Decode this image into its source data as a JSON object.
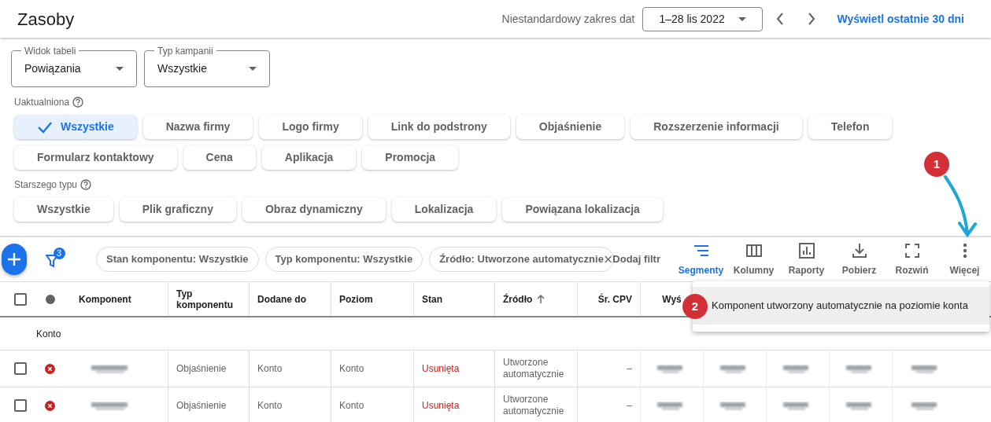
{
  "header": {
    "title": "Zasoby",
    "date_range_label": "Niestandardowy zakres dat",
    "date_range_value": "1–28 lis 2022",
    "link": "Wyświetl ostatnie 30 dni"
  },
  "selects": [
    {
      "label": "Widok tabeli",
      "value": "Powiązania"
    },
    {
      "label": "Typ kampanii",
      "value": "Wszystkie"
    }
  ],
  "chip_groups": [
    {
      "label": "Uaktualniona",
      "chips": [
        {
          "label": "Wszystkie",
          "selected": true
        },
        {
          "label": "Nazwa firmy",
          "selected": false
        },
        {
          "label": "Logo firmy",
          "selected": false
        },
        {
          "label": "Link do podstrony",
          "selected": false
        },
        {
          "label": "Objaśnienie",
          "selected": false
        },
        {
          "label": "Rozszerzenie informacji",
          "selected": false
        },
        {
          "label": "Telefon",
          "selected": false
        },
        {
          "label": "Formularz kontaktowy",
          "selected": false
        },
        {
          "label": "Cena",
          "selected": false
        },
        {
          "label": "Aplikacja",
          "selected": false
        },
        {
          "label": "Promocja",
          "selected": false
        }
      ]
    },
    {
      "label": "Starszego typu",
      "chips": [
        {
          "label": "Wszystkie",
          "selected": false
        },
        {
          "label": "Plik graficzny",
          "selected": false
        },
        {
          "label": "Obraz dynamiczny",
          "selected": false
        },
        {
          "label": "Lokalizacja",
          "selected": false
        },
        {
          "label": "Powiązana lokalizacja",
          "selected": false
        }
      ]
    }
  ],
  "toolbar": {
    "filter_count": "3",
    "filters": [
      "Stan komponentu: Wszystkie",
      "Typ komponentu: Wszystkie",
      "Źródło: Utworzone automatycznie"
    ],
    "add_filter": "Dodaj filtr",
    "actions": [
      {
        "kind": "segments",
        "label": "Segmenty",
        "selected": true
      },
      {
        "kind": "columns",
        "label": "Kolumny",
        "selected": false
      },
      {
        "kind": "reports",
        "label": "Raporty",
        "selected": false
      },
      {
        "kind": "download",
        "label": "Pobierz",
        "selected": false
      },
      {
        "kind": "expand",
        "label": "Rozwiń",
        "selected": false
      },
      {
        "kind": "more",
        "label": "Więcej",
        "selected": false
      }
    ]
  },
  "table": {
    "columns": [
      {
        "label": "Komponent"
      },
      {
        "label": "Typ komponentu"
      },
      {
        "label": "Dodane do"
      },
      {
        "label": "Poziom"
      },
      {
        "label": "Stan"
      },
      {
        "label": "Źródło",
        "sorted_ascending": true
      },
      {
        "label": "Śr. CPV"
      },
      {
        "label": "Wyś"
      }
    ],
    "select_all_checked": false,
    "group_label": "Konto",
    "rows": [
      {
        "checked": false,
        "removed": true,
        "type": "Objaśnienie",
        "added_to": "Konto",
        "level": "Konto",
        "status": "Usunięta",
        "source": "Utworzone automatycznie",
        "cpv": "–"
      },
      {
        "checked": false,
        "removed": true,
        "type": "Objaśnienie",
        "added_to": "Konto",
        "level": "Konto",
        "status": "Usunięta",
        "source": "Utworzone automatycznie",
        "cpv": "–"
      }
    ]
  },
  "menu": {
    "items": [
      {
        "label": "Komponent utworzony automatycznie na poziomie konta"
      }
    ]
  },
  "annotations": [
    {
      "label": "1"
    },
    {
      "label": "2"
    }
  ]
}
